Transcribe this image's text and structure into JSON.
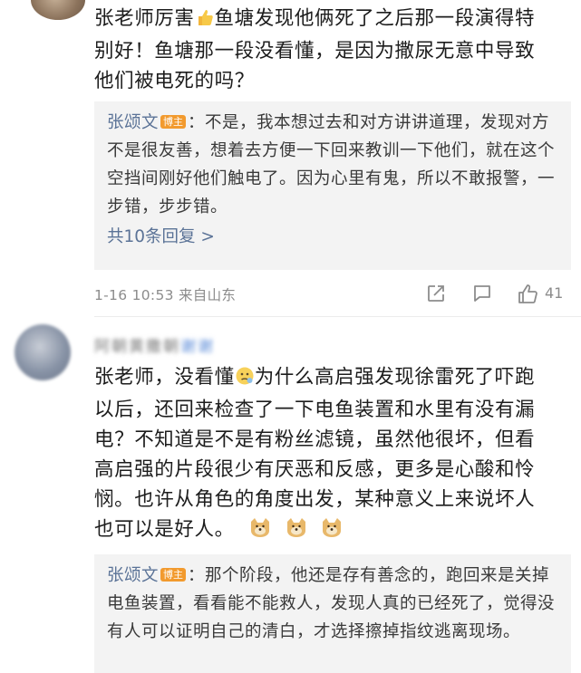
{
  "comment1": {
    "text_lines": [
      "张老师厉害",
      "鱼塘发现他俩死了之后那一段演得特",
      "别好！鱼塘那一段没看懂，是因为撒尿无意中导致",
      "他们被电死的吗？"
    ],
    "emoji": "thumbs-up",
    "reply": {
      "author": "张颂文",
      "badge": "博主",
      "text": "：不是，我本想过去和对方讲讲道理，发现对方不是很友善，想着去方便一下回来教训一下他们，就在这个空挡间刚好他们触电了。因为心里有鬼，所以不敢报警，一步错，步步错。",
      "more": "共10条回复 >"
    },
    "meta": {
      "time_location": "1-16 10:53 来自山东",
      "likes": "41"
    }
  },
  "comment2": {
    "username": "阿朝黄撒朝",
    "username_tail": "谢谢",
    "text_lines": [
      "张老师，没看懂",
      "为什么高启强发现徐雷死了吓跑",
      "以后，还回来检查了一下电鱼装置和水里有没有漏",
      "电？不知道是不是有粉丝滤镜，虽然他很坏，但看",
      "高启强的片段很少有厌恶和反感，更多是心酸和怜",
      "悯。也许从角色的角度出发，某种意义上来说坏人",
      "也可以是好人。"
    ],
    "reply": {
      "author": "张颂文",
      "badge": "博主",
      "text": "：那个阶段，他还是存有善念的，跑回来是关掉电鱼装置，看看能不能救人，发现人真的已经死了，觉得没有人可以证明自己的清白，才选择擦掉指纹逃离现场。"
    }
  },
  "icons": [
    "share-icon",
    "comment-icon",
    "like-icon",
    "emoji-thinking-icon",
    "emoji-doge-icon"
  ]
}
